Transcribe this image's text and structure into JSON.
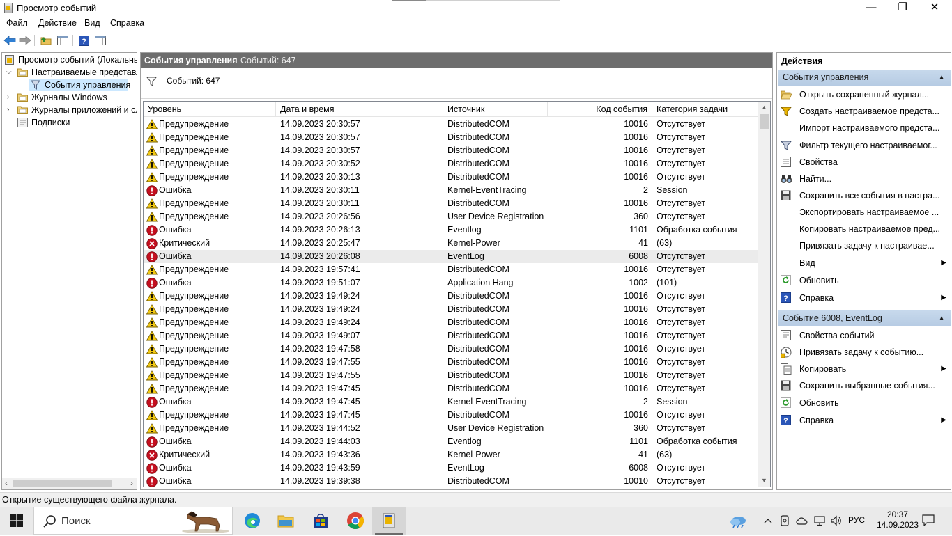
{
  "window": {
    "title": "Просмотр событий",
    "min": "—",
    "max": "❐",
    "close": "✕"
  },
  "menu": [
    "Файл",
    "Действие",
    "Вид",
    "Справка"
  ],
  "tree": {
    "root": "Просмотр событий (Локальнь",
    "custom_views": "Настраиваемые представле",
    "admin_events": "События управления",
    "windows_logs": "Журналы Windows",
    "app_logs": "Журналы приложений и сл",
    "subscriptions": "Подписки"
  },
  "center": {
    "title": "События управления",
    "count": "Событий: 647",
    "filter_text": "Событий: 647",
    "columns": {
      "level": "Уровень",
      "date": "Дата и время",
      "source": "Источник",
      "code": "Код события",
      "category": "Категория задачи"
    }
  },
  "events": [
    {
      "level": "Предупреждение",
      "type": "warning",
      "date": "14.09.2023 20:30:57",
      "source": "DistributedCOM",
      "code": "10016",
      "category": "Отсутствует"
    },
    {
      "level": "Предупреждение",
      "type": "warning",
      "date": "14.09.2023 20:30:57",
      "source": "DistributedCOM",
      "code": "10016",
      "category": "Отсутствует"
    },
    {
      "level": "Предупреждение",
      "type": "warning",
      "date": "14.09.2023 20:30:57",
      "source": "DistributedCOM",
      "code": "10016",
      "category": "Отсутствует"
    },
    {
      "level": "Предупреждение",
      "type": "warning",
      "date": "14.09.2023 20:30:52",
      "source": "DistributedCOM",
      "code": "10016",
      "category": "Отсутствует"
    },
    {
      "level": "Предупреждение",
      "type": "warning",
      "date": "14.09.2023 20:30:13",
      "source": "DistributedCOM",
      "code": "10016",
      "category": "Отсутствует"
    },
    {
      "level": "Ошибка",
      "type": "error",
      "date": "14.09.2023 20:30:11",
      "source": "Kernel-EventTracing",
      "code": "2",
      "category": "Session"
    },
    {
      "level": "Предупреждение",
      "type": "warning",
      "date": "14.09.2023 20:30:11",
      "source": "DistributedCOM",
      "code": "10016",
      "category": "Отсутствует"
    },
    {
      "level": "Предупреждение",
      "type": "warning",
      "date": "14.09.2023 20:26:56",
      "source": "User Device Registration",
      "code": "360",
      "category": "Отсутствует"
    },
    {
      "level": "Ошибка",
      "type": "error",
      "date": "14.09.2023 20:26:13",
      "source": "Eventlog",
      "code": "1101",
      "category": "Обработка события"
    },
    {
      "level": "Критический",
      "type": "critical",
      "date": "14.09.2023 20:25:47",
      "source": "Kernel-Power",
      "code": "41",
      "category": "(63)"
    },
    {
      "level": "Ошибка",
      "type": "error",
      "date": "14.09.2023 20:26:08",
      "source": "EventLog",
      "code": "6008",
      "category": "Отсутствует",
      "selected": true
    },
    {
      "level": "Предупреждение",
      "type": "warning",
      "date": "14.09.2023 19:57:41",
      "source": "DistributedCOM",
      "code": "10016",
      "category": "Отсутствует"
    },
    {
      "level": "Ошибка",
      "type": "error",
      "date": "14.09.2023 19:51:07",
      "source": "Application Hang",
      "code": "1002",
      "category": "(101)"
    },
    {
      "level": "Предупреждение",
      "type": "warning",
      "date": "14.09.2023 19:49:24",
      "source": "DistributedCOM",
      "code": "10016",
      "category": "Отсутствует"
    },
    {
      "level": "Предупреждение",
      "type": "warning",
      "date": "14.09.2023 19:49:24",
      "source": "DistributedCOM",
      "code": "10016",
      "category": "Отсутствует"
    },
    {
      "level": "Предупреждение",
      "type": "warning",
      "date": "14.09.2023 19:49:24",
      "source": "DistributedCOM",
      "code": "10016",
      "category": "Отсутствует"
    },
    {
      "level": "Предупреждение",
      "type": "warning",
      "date": "14.09.2023 19:49:07",
      "source": "DistributedCOM",
      "code": "10016",
      "category": "Отсутствует"
    },
    {
      "level": "Предупреждение",
      "type": "warning",
      "date": "14.09.2023 19:47:58",
      "source": "DistributedCOM",
      "code": "10016",
      "category": "Отсутствует"
    },
    {
      "level": "Предупреждение",
      "type": "warning",
      "date": "14.09.2023 19:47:55",
      "source": "DistributedCOM",
      "code": "10016",
      "category": "Отсутствует"
    },
    {
      "level": "Предупреждение",
      "type": "warning",
      "date": "14.09.2023 19:47:55",
      "source": "DistributedCOM",
      "code": "10016",
      "category": "Отсутствует"
    },
    {
      "level": "Предупреждение",
      "type": "warning",
      "date": "14.09.2023 19:47:45",
      "source": "DistributedCOM",
      "code": "10016",
      "category": "Отсутствует"
    },
    {
      "level": "Ошибка",
      "type": "error",
      "date": "14.09.2023 19:47:45",
      "source": "Kernel-EventTracing",
      "code": "2",
      "category": "Session"
    },
    {
      "level": "Предупреждение",
      "type": "warning",
      "date": "14.09.2023 19:47:45",
      "source": "DistributedCOM",
      "code": "10016",
      "category": "Отсутствует"
    },
    {
      "level": "Предупреждение",
      "type": "warning",
      "date": "14.09.2023 19:44:52",
      "source": "User Device Registration",
      "code": "360",
      "category": "Отсутствует"
    },
    {
      "level": "Ошибка",
      "type": "error",
      "date": "14.09.2023 19:44:03",
      "source": "Eventlog",
      "code": "1101",
      "category": "Обработка события"
    },
    {
      "level": "Критический",
      "type": "critical",
      "date": "14.09.2023 19:43:36",
      "source": "Kernel-Power",
      "code": "41",
      "category": "(63)"
    },
    {
      "level": "Ошибка",
      "type": "error",
      "date": "14.09.2023 19:43:59",
      "source": "EventLog",
      "code": "6008",
      "category": "Отсутствует"
    },
    {
      "level": "Ошибка",
      "type": "error",
      "date": "14.09.2023 19:39:38",
      "source": "DistributedCOM",
      "code": "10010",
      "category": "Отсутствует"
    }
  ],
  "actions": {
    "title": "Действия",
    "section1": "События управления",
    "items1": [
      {
        "label": "Открыть сохраненный журнал...",
        "icon": "folder-open-icon"
      },
      {
        "label": "Создать настраиваемое предста...",
        "icon": "filter-create-icon"
      },
      {
        "label": "Импорт настраиваемого предста...",
        "icon": ""
      },
      {
        "label": "Фильтр текущего настраиваемог...",
        "icon": "filter-icon"
      },
      {
        "label": "Свойства",
        "icon": "properties-icon"
      },
      {
        "label": "Найти...",
        "icon": "binoculars-icon"
      },
      {
        "label": "Сохранить все события в настра...",
        "icon": "save-icon"
      },
      {
        "label": "Экспортировать настраиваемое ...",
        "icon": ""
      },
      {
        "label": "Копировать настраиваемое пред...",
        "icon": ""
      },
      {
        "label": "Привязать задачу к настраивае...",
        "icon": ""
      },
      {
        "label": "Вид",
        "icon": "",
        "submenu": true
      },
      {
        "label": "Обновить",
        "icon": "refresh-icon"
      },
      {
        "label": "Справка",
        "icon": "help-icon",
        "submenu": true
      }
    ],
    "section2": "Событие 6008, EventLog",
    "items2": [
      {
        "label": "Свойства событий",
        "icon": "event-properties-icon"
      },
      {
        "label": "Привязать задачу к событию...",
        "icon": "task-icon"
      },
      {
        "label": "Копировать",
        "icon": "copy-icon",
        "submenu": true
      },
      {
        "label": "Сохранить выбранные события...",
        "icon": "save-icon"
      },
      {
        "label": "Обновить",
        "icon": "refresh-icon"
      },
      {
        "label": "Справка",
        "icon": "help-icon",
        "submenu": true
      }
    ]
  },
  "status": {
    "text": "Открытие существующего файла журнала."
  },
  "taskbar": {
    "search_placeholder": "Поиск",
    "lang": "РУС",
    "time": "20:37",
    "date": "14.09.2023"
  },
  "colors": {
    "header_bg": "#6d6d6d",
    "section_bg": "#b6cbe3",
    "warning": "#f2c811",
    "error": "#c50f1f",
    "selection": "#cce8ff"
  }
}
